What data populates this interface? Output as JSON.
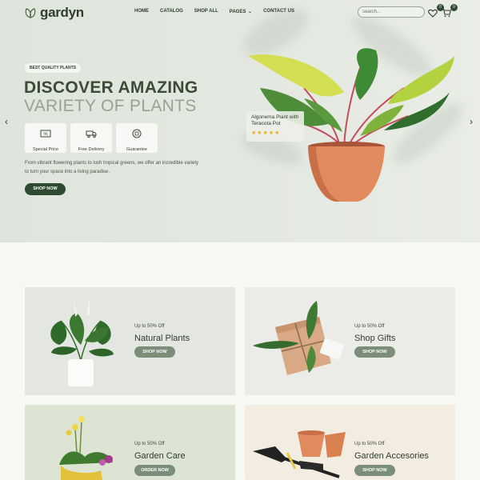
{
  "brand": {
    "name": "gardyn"
  },
  "nav": {
    "items": [
      "HOME",
      "CATALOG",
      "SHOP ALL",
      "PAGES",
      "CONTACT US"
    ],
    "pages_chevron": "⌄"
  },
  "search": {
    "placeholder": "search..."
  },
  "header_icons": {
    "wishlist_count": "0",
    "cart_count": "0"
  },
  "hero": {
    "tag": "BEST QUALITY PLANTS",
    "title_line1": "DISCOVER AMAZING",
    "title_line2": "VARIETY OF PLANTS",
    "features": [
      {
        "label": "Special Price",
        "icon": "price-tag-icon"
      },
      {
        "label": "Free Delivery",
        "icon": "truck-icon"
      },
      {
        "label": "Guarantee",
        "icon": "guarantee-icon"
      }
    ],
    "description": "From vibrant flowering plants to lush tropical greens, we offer an incredible variety to turn your space into a living paradise.",
    "cta": "SHOP NOW",
    "prev_arrow": "‹",
    "next_arrow": "›",
    "product": {
      "name": "Algonema Plant with Teracota Pot",
      "rating": 5,
      "stars": "★★★★★"
    }
  },
  "categories": [
    {
      "offer": "Up to 50% Off",
      "name": "Natural Plants",
      "button": "SHOP NOW",
      "bg": "#e4e6e1"
    },
    {
      "offer": "Up to 50% Off",
      "name": "Shop Gifts",
      "button": "SHOP NOW",
      "bg": "#ebebe8"
    },
    {
      "offer": "Up to 50% Off",
      "name": "Garden Care",
      "button": "ORDER NOW",
      "bg": "#dde4d4"
    },
    {
      "offer": "Up to 50% Off",
      "name": "Garden Accesories",
      "button": "SHOP NOW",
      "bg": "#f3ece1"
    }
  ],
  "colors": {
    "accent_dark": "#2f4a30",
    "accent_muted": "#7a8e78",
    "title": "#3b4b36",
    "title_light": "#97a38f",
    "star": "#e9a920"
  }
}
